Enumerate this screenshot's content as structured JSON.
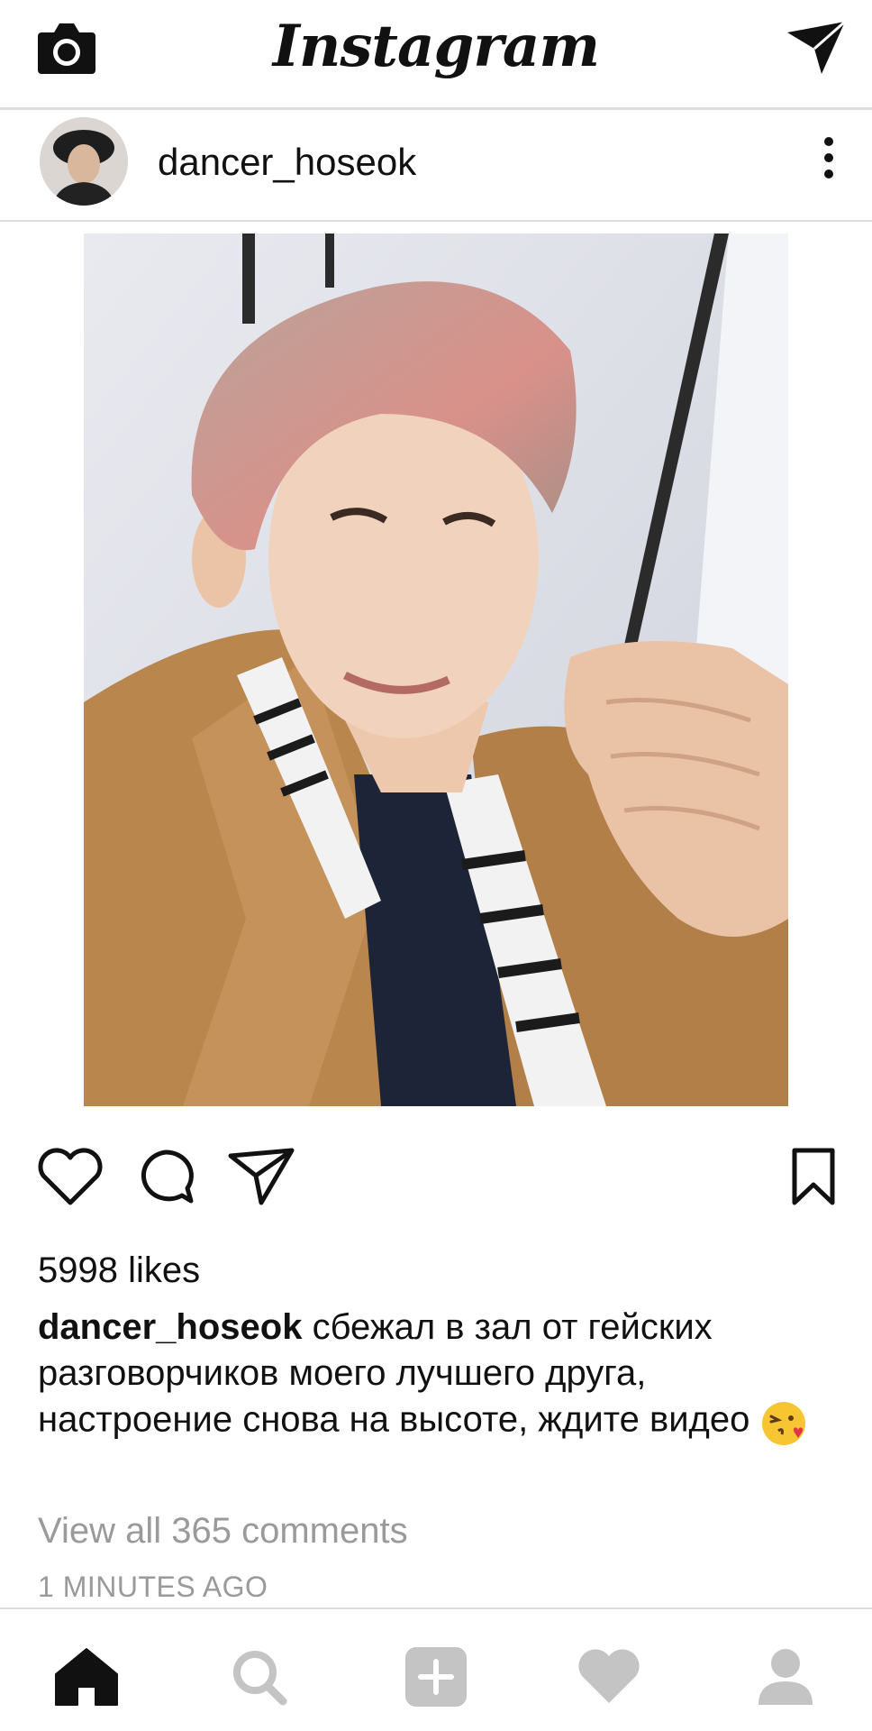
{
  "app": {
    "title": "Instagram"
  },
  "post": {
    "username": "dancer_hoseok",
    "likes": "5998 likes",
    "caption_user": "dancer_hoseok",
    "caption_text": "сбежал в зал от гейских разговорчиков моего лучшего друга, настроение снова на высоте, ждите видео",
    "caption_emoji": "face-blowing-kiss-emoji",
    "comments_link": "View all 365 comments",
    "timestamp": "1 MINUTES AGO"
  },
  "icons": {
    "top_left": "camera-icon",
    "top_right": "direct-message-icon",
    "post_menu": "more-vertical-icon",
    "actions": [
      "heart-icon",
      "comment-icon",
      "share-icon",
      "bookmark-icon"
    ],
    "tabs": [
      "home-icon",
      "search-icon",
      "add-post-icon",
      "activity-heart-icon",
      "profile-icon"
    ]
  },
  "colors": {
    "text": "#111111",
    "muted": "#9a9a9a",
    "divider": "#dedede",
    "inactive_tab": "#c4c4c4"
  }
}
